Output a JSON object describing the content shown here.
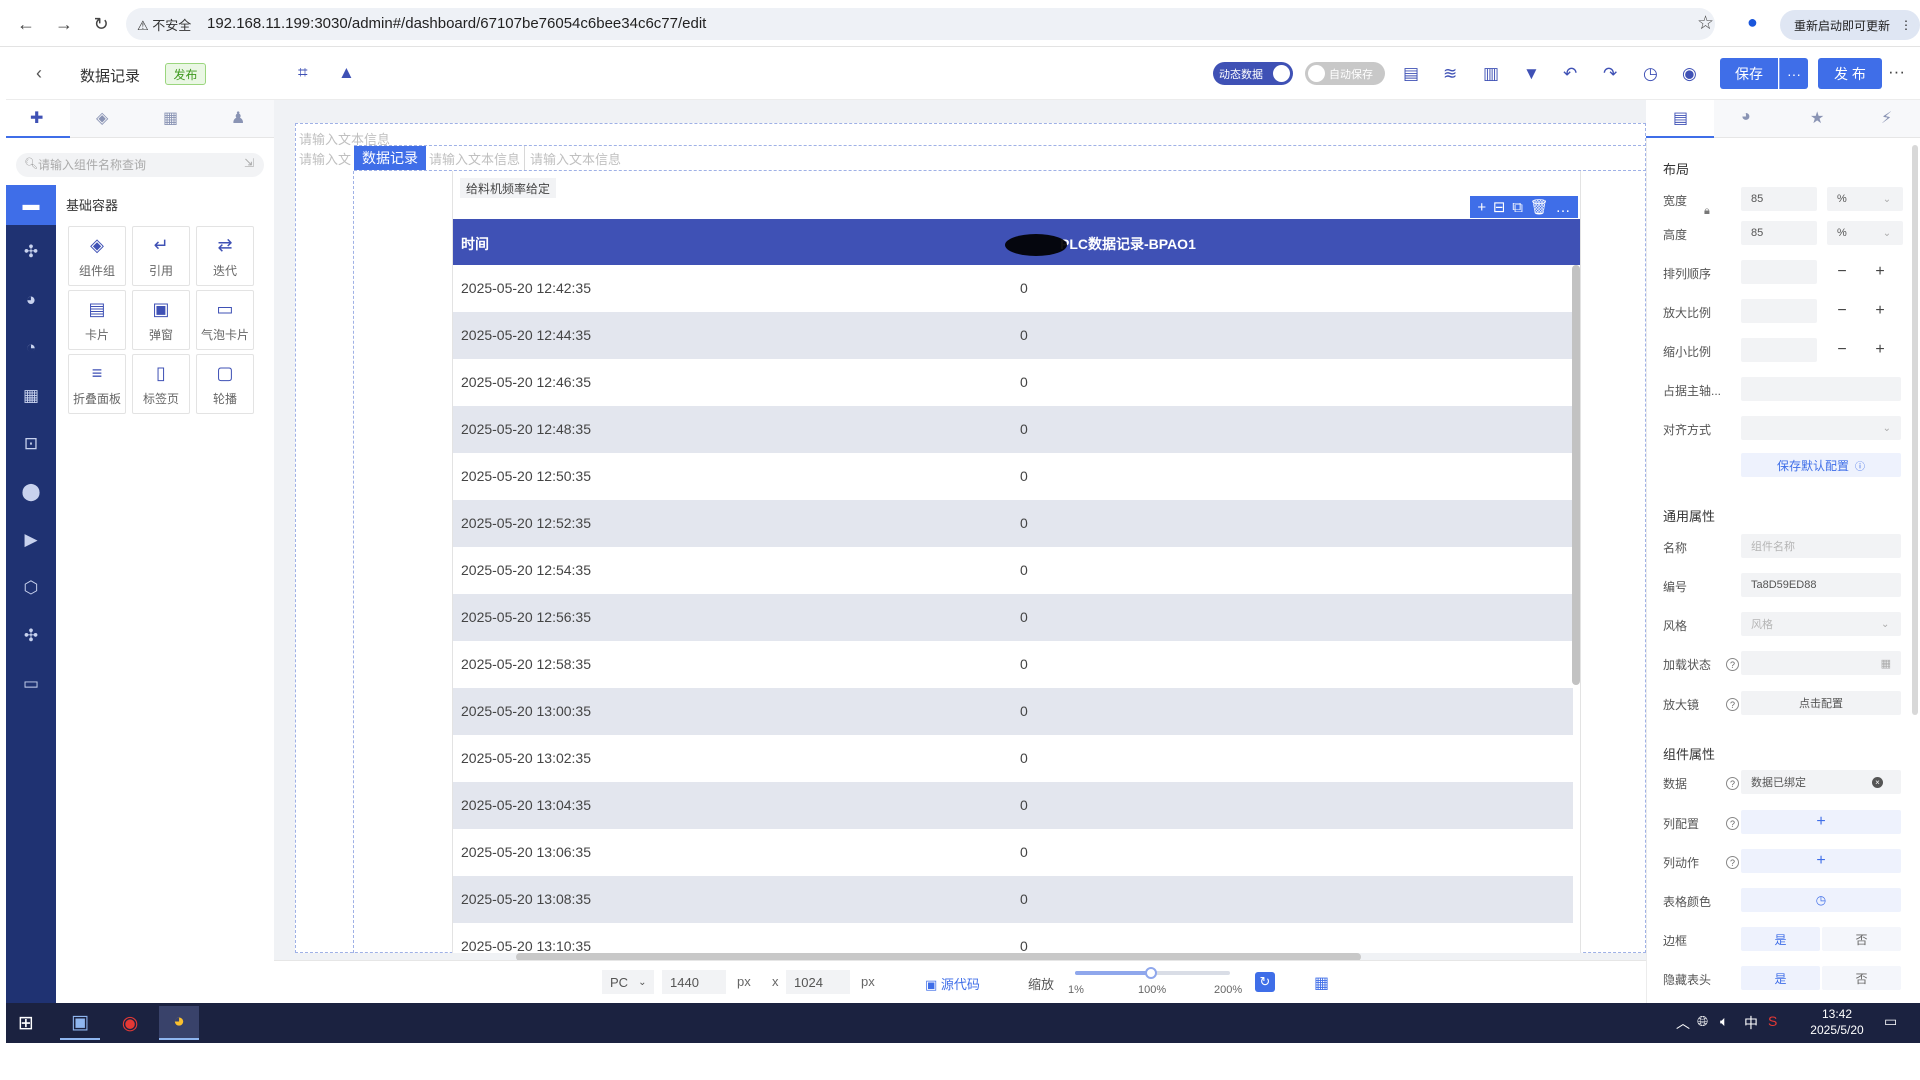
{
  "browser": {
    "insecure_label": "不安全",
    "url": "192.168.11.199:3030/admin#/dashboard/67107be76054c6bee34c6c77/edit",
    "update_label": "重新启动即可更新"
  },
  "toolbar": {
    "page_title": "数据记录",
    "publish_badge": "发布",
    "dynamic_data_label": "动态数据",
    "auto_save_label": "自动保存",
    "save_label": "保存",
    "more_label": "···",
    "publish_label": "发 布"
  },
  "left_panel": {
    "search_placeholder": "请输入组件名称查询",
    "section_title": "基础容器",
    "components": [
      {
        "label": "组件组",
        "icon": "layers-icon"
      },
      {
        "label": "引用",
        "icon": "return-icon"
      },
      {
        "label": "迭代",
        "icon": "repeat-icon"
      },
      {
        "label": "卡片",
        "icon": "card-icon"
      },
      {
        "label": "弹窗",
        "icon": "dialog-icon"
      },
      {
        "label": "气泡卡片",
        "icon": "bubble-icon"
      },
      {
        "label": "折叠面板",
        "icon": "collapse-icon"
      },
      {
        "label": "标签页",
        "icon": "tabs-icon"
      },
      {
        "label": "轮播",
        "icon": "carousel-icon"
      }
    ]
  },
  "canvas": {
    "ghost_text": "请输入文本信息",
    "ghost_text_short": "请输入文",
    "active_tab": "数据记录",
    "table_label": "给料机频率给定",
    "table_tools": [
      "+",
      "⊟",
      "⧉",
      "🗑",
      "…"
    ],
    "table": {
      "header_time": "时间",
      "header_value": "PLC数据记录-BPAO1",
      "rows": [
        {
          "time": "2025-05-20 12:42:35",
          "value": "0"
        },
        {
          "time": "2025-05-20 12:44:35",
          "value": "0"
        },
        {
          "time": "2025-05-20 12:46:35",
          "value": "0"
        },
        {
          "time": "2025-05-20 12:48:35",
          "value": "0"
        },
        {
          "time": "2025-05-20 12:50:35",
          "value": "0"
        },
        {
          "time": "2025-05-20 12:52:35",
          "value": "0"
        },
        {
          "time": "2025-05-20 12:54:35",
          "value": "0"
        },
        {
          "time": "2025-05-20 12:56:35",
          "value": "0"
        },
        {
          "time": "2025-05-20 12:58:35",
          "value": "0"
        },
        {
          "time": "2025-05-20 13:00:35",
          "value": "0"
        },
        {
          "time": "2025-05-20 13:02:35",
          "value": "0"
        },
        {
          "time": "2025-05-20 13:04:35",
          "value": "0"
        },
        {
          "time": "2025-05-20 13:06:35",
          "value": "0"
        },
        {
          "time": "2025-05-20 13:08:35",
          "value": "0"
        },
        {
          "time": "2025-05-20 13:10:35",
          "value": "0"
        }
      ]
    }
  },
  "bottom_bar": {
    "device": "PC",
    "width": "1440",
    "height": "1024",
    "unit": "px",
    "times": "x",
    "source_code": "源代码",
    "zoom_label": "缩放",
    "zoom_min": "1%",
    "zoom_mid": "100%",
    "zoom_max": "200%"
  },
  "right_panel": {
    "layout_title": "布局",
    "width_label": "宽度",
    "width_value": "85",
    "width_unit": "%",
    "height_label": "高度",
    "height_value": "85",
    "height_unit": "%",
    "order_label": "排列顺序",
    "grow_label": "放大比例",
    "shrink_label": "缩小比例",
    "basis_label": "占据主轴...",
    "align_label": "对齐方式",
    "save_default": "保存默认配置",
    "common_title": "通用属性",
    "name_label": "名称",
    "name_placeholder": "组件名称",
    "id_label": "编号",
    "id_value": "Ta8D59ED88",
    "style_label": "风格",
    "style_placeholder": "风格",
    "loading_label": "加载状态",
    "magnifier_label": "放大镜",
    "magnifier_value": "点击配置",
    "component_title": "组件属性",
    "data_label": "数据",
    "data_value": "数据已绑定",
    "column_config_label": "列配置",
    "column_action_label": "列动作",
    "table_color_label": "表格颜色",
    "border_label": "边框",
    "hide_header_label": "隐藏表头",
    "yes": "是",
    "no": "否",
    "plus": "+"
  },
  "taskbar": {
    "ime": "中",
    "time": "13:42",
    "date": "2025/5/20"
  }
}
